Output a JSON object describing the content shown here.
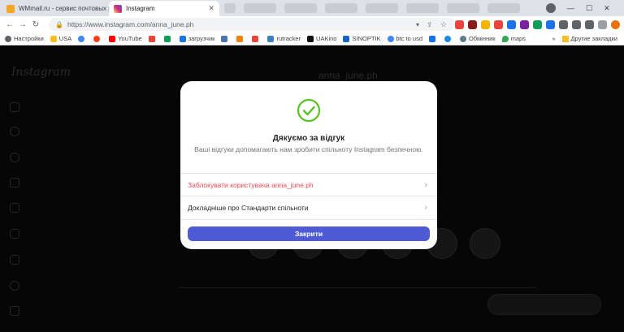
{
  "browser": {
    "tabs": [
      {
        "title": "WMmail.ru - сервис почтовых ра",
        "favicon_color": "#f5a623"
      },
      {
        "title": "Instagram",
        "favicon_color": "#d62976"
      }
    ],
    "url": "https://www.instagram.com/anna_june.ph",
    "bookmarks": [
      "Настройки",
      "USA",
      "YouTube",
      "загрузчик",
      "rutracker",
      "UAKino",
      "SINOPTIK",
      "btc to usd",
      "Обмінник",
      "maps"
    ],
    "bookmarks_other": "Другие закладки"
  },
  "page": {
    "profile_name": "anna_june.ph",
    "logo": "Instagram"
  },
  "modal": {
    "title": "Дякуємо за відгук",
    "subtitle": "Ваші відгуки допомагають нам зробити спільноту Instagram безпечною.",
    "block_label": "Заблокувати користувача anna_june.ph",
    "standards_label": "Докладніше про Стандарти спільноти",
    "close_label": "Закрити",
    "check_color": "#58c322",
    "danger_color": "#ed4956",
    "button_color": "#4f5bd5"
  }
}
